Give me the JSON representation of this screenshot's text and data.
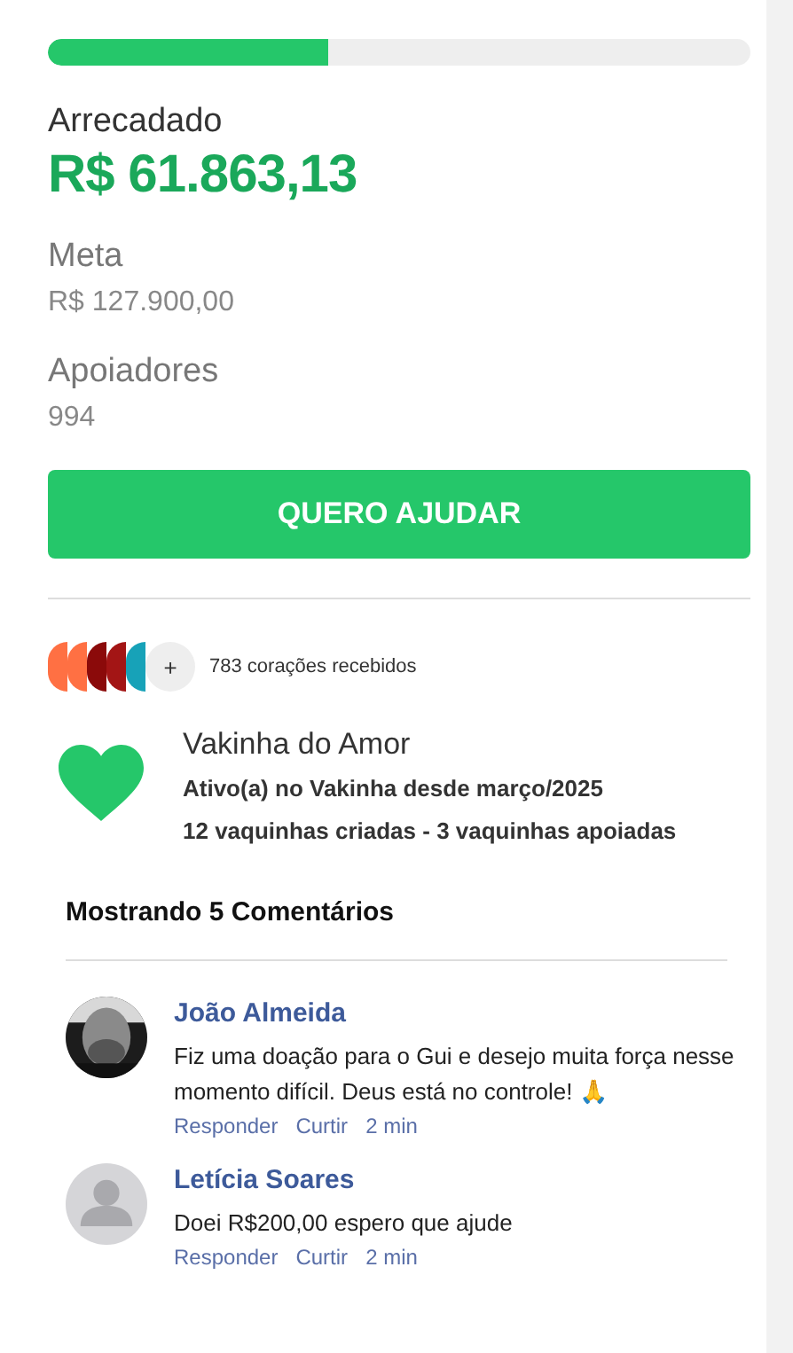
{
  "progress": {
    "level": 0.4
  },
  "raised": {
    "label": "Arrecadado",
    "value": "R$ 61.863,13"
  },
  "goal": {
    "label": "Meta",
    "value": "R$ 127.900,00"
  },
  "supporters": {
    "label": "Apoiadores",
    "value": "994"
  },
  "help_button": "QUERO AJUDAR",
  "hearts": {
    "avatars": [
      {
        "color": "#ff7043"
      },
      {
        "color": "#ff7043"
      },
      {
        "color": "#8b0a0a"
      },
      {
        "color": "#a31515"
      },
      {
        "color": "#17a2b8"
      }
    ],
    "more": "+",
    "text": "783 corações recebidos"
  },
  "organizer": {
    "name": "Vakinha do Amor",
    "since": "Ativo(a) no Vakinha desde março/2025",
    "stats": "12 vaquinhas criadas - 3 vaquinhas apoiadas"
  },
  "comments_title": "Mostrando 5 Comentários",
  "comments": [
    {
      "author": "João Almeida",
      "text": "Fiz uma doação para o Gui e desejo muita força nesse momento difícil. Deus está no controle! 🙏",
      "reply": "Responder",
      "like": "Curtir",
      "time": "2 min"
    },
    {
      "kind": "default",
      "author": "Letícia Soares",
      "text": "Doei R$200,00 espero que ajude",
      "reply": "Responder",
      "like": "Curtir",
      "time": "2 min"
    }
  ]
}
